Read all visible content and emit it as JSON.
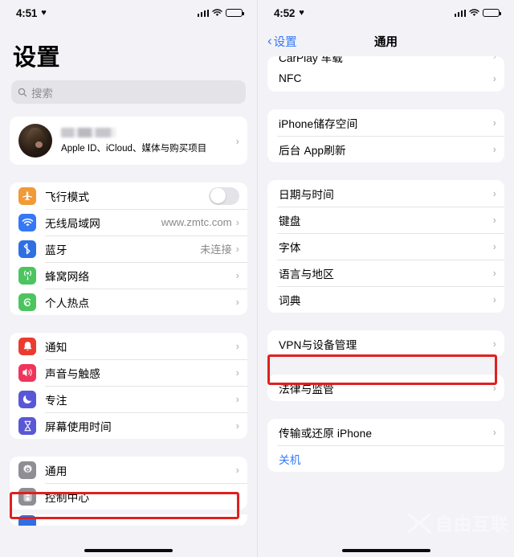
{
  "left": {
    "status": {
      "time": "4:51",
      "heart_icon": "heart-icon",
      "signal_icon": "signal-bars-icon",
      "wifi_icon": "wifi-icon",
      "battery_icon": "battery-low-icon"
    },
    "title": "设置",
    "search": {
      "placeholder": "搜索",
      "icon": "search-icon"
    },
    "profile": {
      "name": "",
      "subtitle": "Apple ID、iCloud、媒体与购买项目",
      "avatar": "user-avatar"
    },
    "group_connectivity": [
      {
        "label": "飞行模式",
        "icon": "airplane-icon",
        "color": "#f09a38",
        "control": "toggle",
        "toggle_on": false
      },
      {
        "label": "无线局域网",
        "icon": "wifi-icon",
        "color": "#3478f6",
        "value": "www.zmtc.com"
      },
      {
        "label": "蓝牙",
        "icon": "bluetooth-icon",
        "color": "#2f6fe4",
        "value": "未连接"
      },
      {
        "label": "蜂窝网络",
        "icon": "cellular-icon",
        "color": "#4cc45f"
      },
      {
        "label": "个人热点",
        "icon": "hotspot-icon",
        "color": "#4cc45f"
      }
    ],
    "group_alerts": [
      {
        "label": "通知",
        "icon": "bell-icon",
        "color": "#eb3b30"
      },
      {
        "label": "声音与触感",
        "icon": "speaker-icon",
        "color": "#f0355a"
      },
      {
        "label": "专注",
        "icon": "moon-icon",
        "color": "#5a57d6"
      },
      {
        "label": "屏幕使用时间",
        "icon": "hourglass-icon",
        "color": "#5a57d6"
      }
    ],
    "group_system": [
      {
        "label": "通用",
        "icon": "gear-icon",
        "color": "#8e8e93",
        "highlighted": true
      },
      {
        "label": "控制中心",
        "icon": "sliders-icon",
        "color": "#8e8e93"
      }
    ],
    "highlight_color": "#e02020"
  },
  "right": {
    "status": {
      "time": "4:52",
      "heart_icon": "heart-icon",
      "signal_icon": "signal-bars-icon",
      "wifi_icon": "wifi-icon",
      "battery_icon": "battery-low-icon"
    },
    "nav": {
      "back_label": "设置",
      "back_icon": "chevron-left-icon",
      "title": "通用"
    },
    "group_nfc": [
      {
        "label": "NFC"
      }
    ],
    "group_storage": [
      {
        "label": "iPhone储存空间"
      },
      {
        "label": "后台 App刷新"
      }
    ],
    "group_locale": [
      {
        "label": "日期与时间"
      },
      {
        "label": "键盘"
      },
      {
        "label": "字体"
      },
      {
        "label": "语言与地区"
      },
      {
        "label": "词典"
      }
    ],
    "group_vpn": [
      {
        "label": "VPN与设备管理",
        "highlighted": true
      }
    ],
    "group_legal": [
      {
        "label": "法律与监管"
      }
    ],
    "group_reset": [
      {
        "label": "传输或还原 iPhone"
      },
      {
        "label": "关机",
        "style": "blue"
      }
    ],
    "watermark": {
      "text": "自由互联",
      "logo": "x-logo-icon"
    },
    "highlight_color": "#e02020"
  }
}
